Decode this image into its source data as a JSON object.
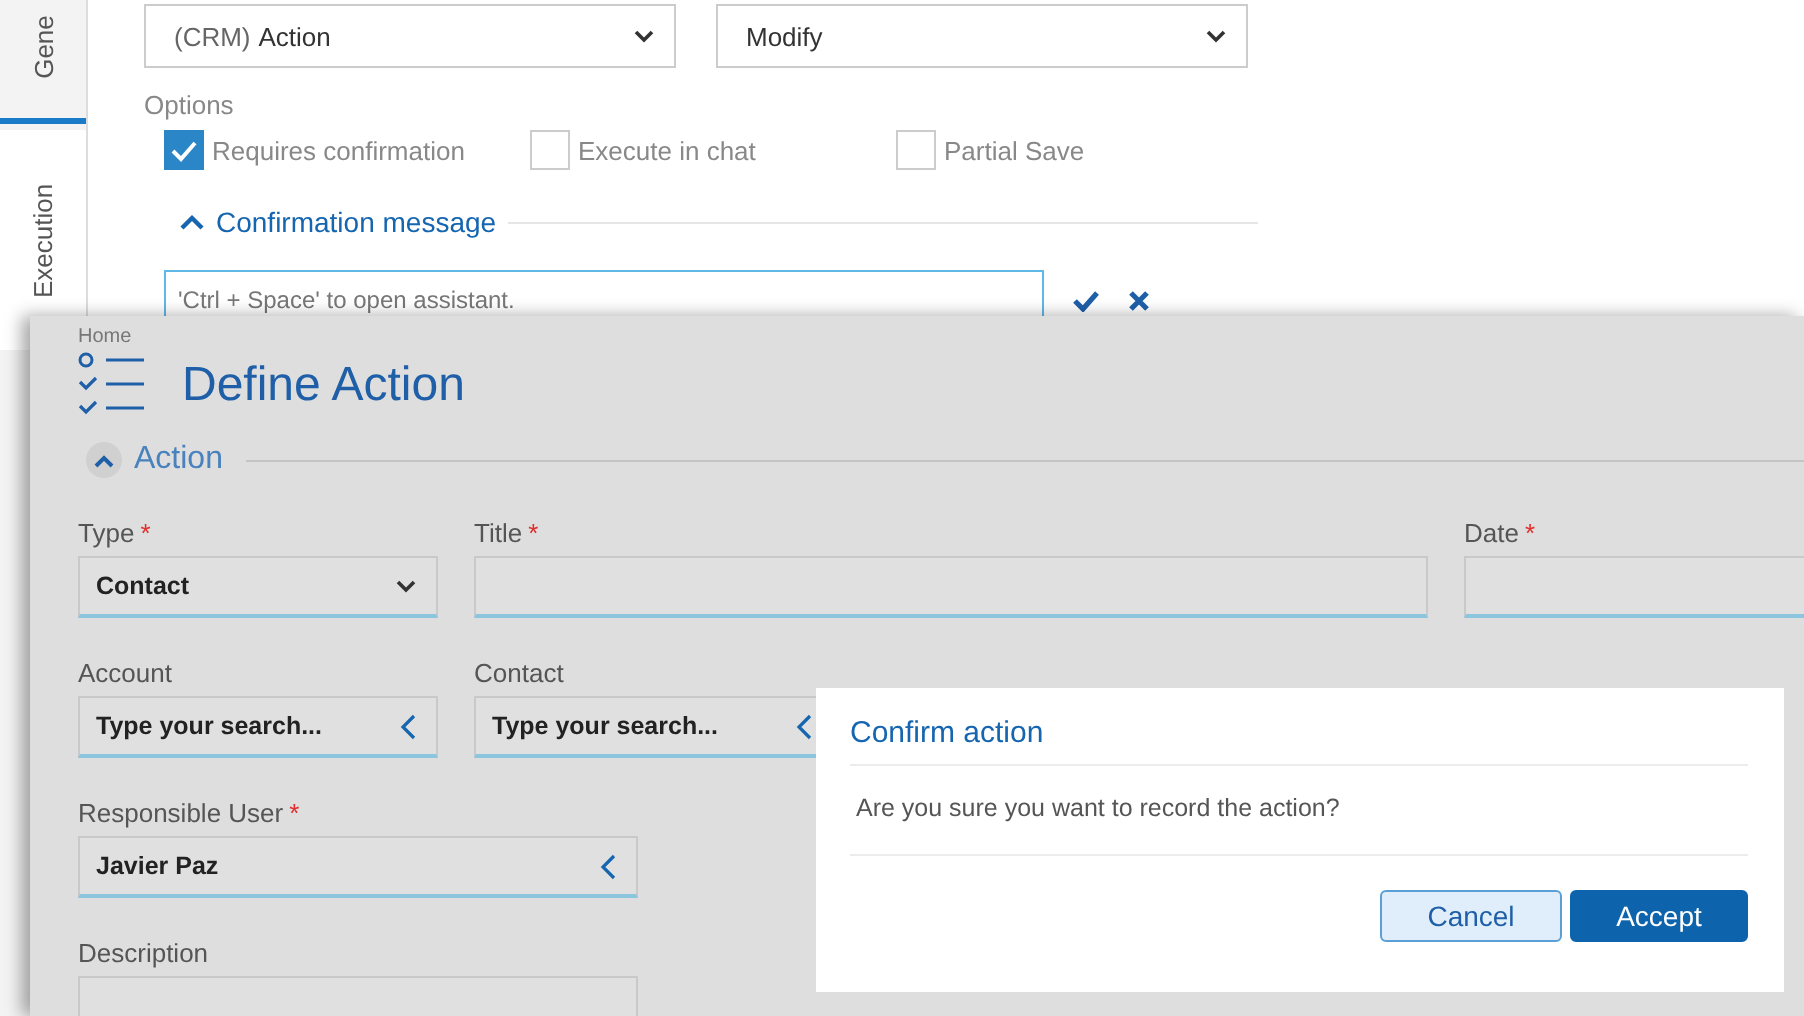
{
  "side_tabs": [
    {
      "label": "Gene",
      "selected": true
    },
    {
      "label": "Execution",
      "selected": false
    }
  ],
  "action_selects": [
    {
      "prefix": "(CRM)",
      "value": "Action"
    },
    {
      "value": "Modify"
    }
  ],
  "options": {
    "label": "Options",
    "items": [
      {
        "label": "Requires confirmation",
        "checked": true
      },
      {
        "label": "Execute in chat",
        "checked": false
      },
      {
        "label": "Partial Save",
        "checked": false
      }
    ]
  },
  "confirmation_section": {
    "title": "Confirmation message",
    "expanded": true,
    "placeholder": "'Ctrl + Space' to open assistant."
  },
  "define_window": {
    "breadcrumb": "Home",
    "title": "Define Action",
    "section": {
      "title": "Action",
      "expanded": true
    },
    "rows": [
      [
        {
          "kind": "select",
          "label": "Type",
          "required_mark": "*",
          "value": "Contact"
        },
        {
          "kind": "text",
          "label": "Title",
          "required_mark": "*"
        },
        {
          "kind": "text",
          "label": "Date",
          "required_mark": "*"
        }
      ],
      [
        {
          "kind": "search",
          "label": "Account",
          "placeholder": "Type your search..."
        },
        {
          "kind": "search",
          "label": "Contact",
          "placeholder": "Type your search..."
        }
      ],
      [
        {
          "kind": "search",
          "label": "Responsible User",
          "required_mark": "*",
          "value": "Javier Paz"
        }
      ],
      [
        {
          "kind": "textarea",
          "label": "Description"
        }
      ]
    ]
  },
  "dialog": {
    "title": "Confirm action",
    "message": "Are you sure you want to record the action?",
    "buttons": [
      {
        "label": "Cancel",
        "kind": "secondary"
      },
      {
        "label": "Accept",
        "kind": "primary"
      }
    ]
  }
}
